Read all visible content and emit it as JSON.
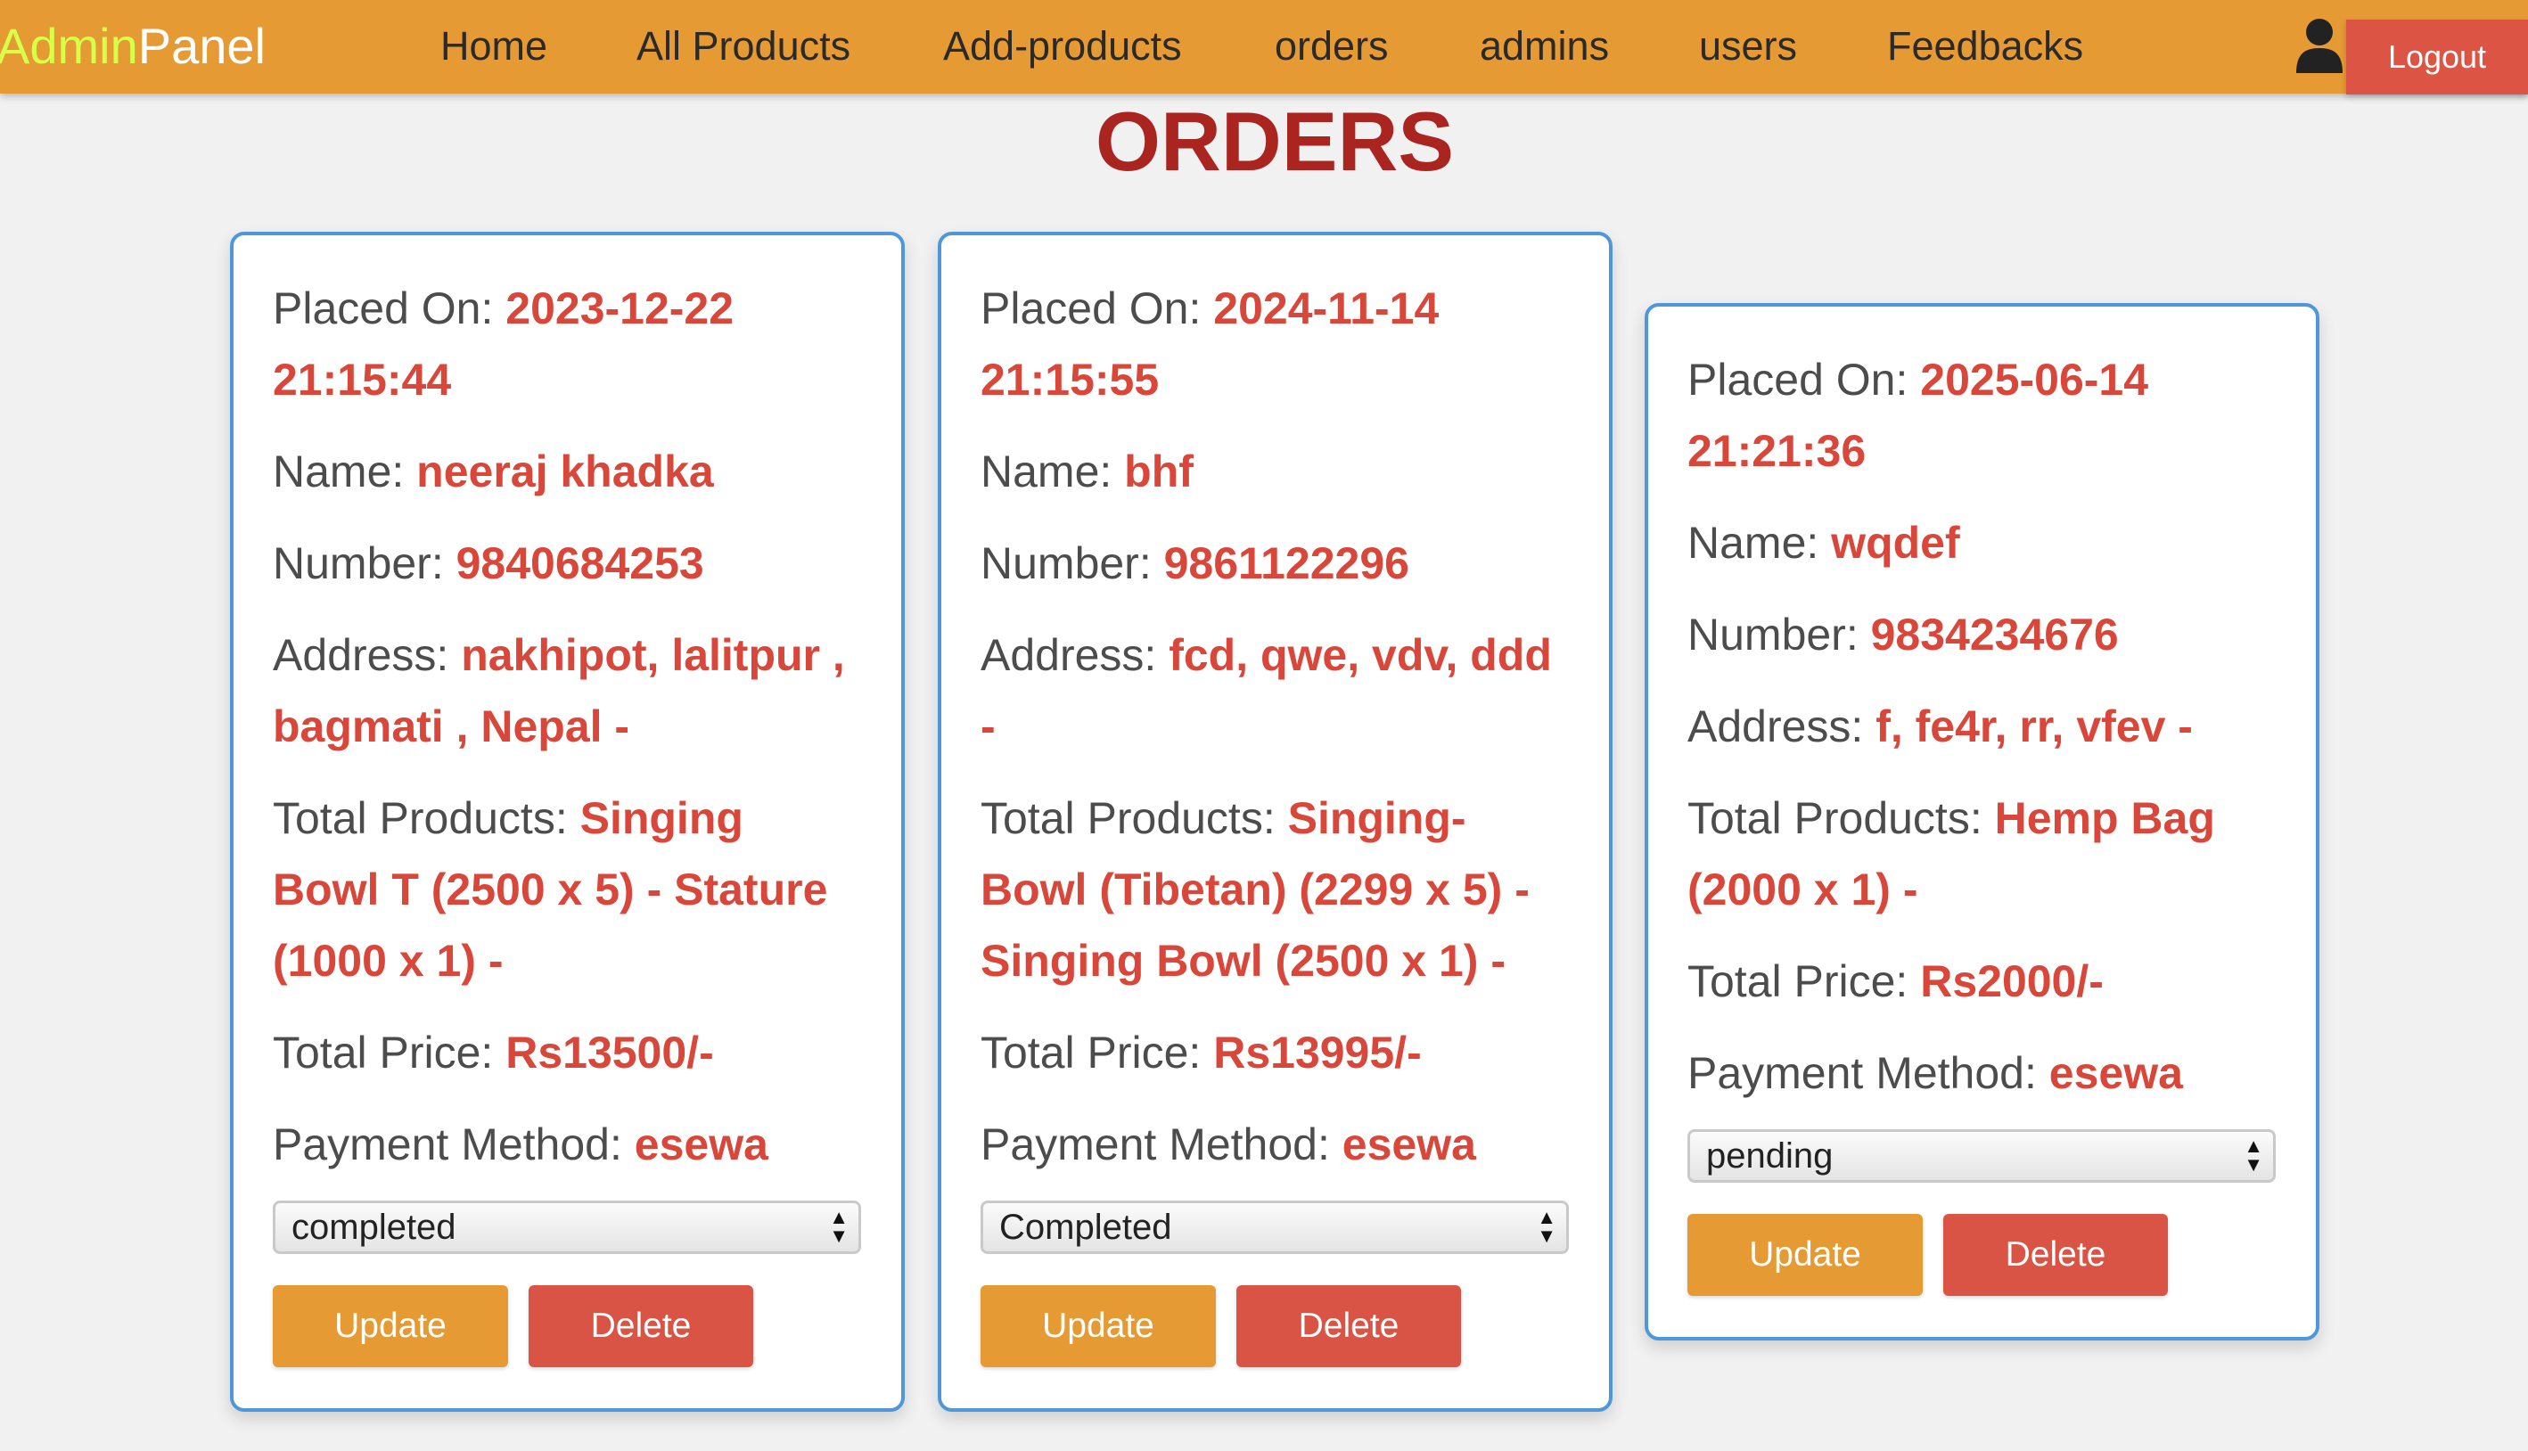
{
  "header": {
    "logo_part1": "Admin",
    "logo_part2": "Panel",
    "nav": [
      "Home",
      "All Products",
      "Add-products",
      "orders",
      "admins",
      "users",
      "Feedbacks"
    ],
    "logout_label": "Logout",
    "user_icon": "user-icon"
  },
  "page": {
    "title": "ORDERS"
  },
  "labels": {
    "placed_on": "Placed On: ",
    "name": "Name: ",
    "number": "Number: ",
    "address": "Address: ",
    "total_products": "Total Products: ",
    "total_price": "Total Price: ",
    "payment_method": "Payment Method: ",
    "update": "Update",
    "delete": "Delete"
  },
  "orders": [
    {
      "placed_on": "2023-12-22 21:15:44",
      "name": "neeraj khadka",
      "number": "9840684253",
      "address": "nakhipot, lalitpur , bagmati , Nepal -",
      "total_products": "Singing Bowl T (2500 x 5) - Stature (1000 x 1) -",
      "total_price": "Rs13500/-",
      "payment_method": "esewa",
      "status": "completed"
    },
    {
      "placed_on": "2024-11-14 21:15:55",
      "name": "bhf",
      "number": "9861122296",
      "address": "fcd, qwe, vdv, ddd -",
      "total_products": "Singing-Bowl (Tibetan) (2299 x 5) - Singing Bowl (2500 x 1) -",
      "total_price": "Rs13995/-",
      "payment_method": "esewa",
      "status": "Completed"
    },
    {
      "placed_on": "2025-06-14 21:21:36",
      "name": "wqdef",
      "number": "9834234676",
      "address": "f, fe4r, rr, vfev -",
      "total_products": "Hemp Bag (2000 x 1) -",
      "total_price": "Rs2000/-",
      "payment_method": "esewa",
      "status": "pending"
    }
  ]
}
